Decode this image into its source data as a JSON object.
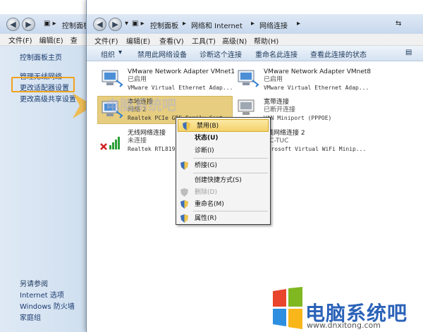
{
  "back_window": {
    "breadcrumb": "控制面板",
    "menu": [
      "文件(F)",
      "编辑(E)",
      "查"
    ],
    "sidebar": {
      "home": "控制面板主页",
      "links": [
        "管理无线网络",
        "更改适配器设置",
        "更改高级共享设置"
      ],
      "see_also_title": "另请参阅",
      "see_also": [
        "Internet 选项",
        "Windows 防火墙",
        "家庭组"
      ]
    }
  },
  "front_window": {
    "breadcrumb": [
      "控制面板",
      "网络和 Internet",
      "网络连接"
    ],
    "menu": [
      "文件(F)",
      "编辑(E)",
      "查看(V)",
      "工具(T)",
      "高级(N)",
      "帮助(H)"
    ],
    "toolbar": [
      "组织",
      "禁用此网络设备",
      "诊断这个连接",
      "重命名此连接",
      "查看此连接的状态"
    ],
    "adapters": [
      {
        "name": "VMware Network Adapter VMnet1",
        "status": "已启用",
        "device": "VMware Virtual Ethernet Adap..."
      },
      {
        "name": "VMware Network Adapter VMnet8",
        "status": "已启用",
        "device": "VMware Virtual Ethernet Adap..."
      },
      {
        "name": "本地连接",
        "status": "网络 2",
        "device": "Realtek PCIe GBE Family Cont..."
      },
      {
        "name": "宽带连接",
        "status": "已断开连接",
        "device": "WAN Miniport (PPPOE)"
      },
      {
        "name": "无线网络连接",
        "status": "未连接",
        "device": "Realtek RTL819"
      },
      {
        "name": "无线网络连接 2",
        "status": "ACC-TUC",
        "device": "Microsoft Virtual WiFi Minip..."
      }
    ]
  },
  "context_menu": {
    "items": [
      "禁用(B)",
      "状态(U)",
      "诊断(I)",
      "桥接(G)",
      "创建快捷方式(S)",
      "删除(D)",
      "重命名(M)",
      "属性(R)"
    ]
  },
  "watermark": "电脑系统吧",
  "logo": {
    "text": "电脑系统吧",
    "url": "www.dnxitong.com"
  },
  "colors": {
    "highlight_box": "#f0a21c",
    "selection": "#dcb94a",
    "logo_blue": "#2a62b8"
  }
}
